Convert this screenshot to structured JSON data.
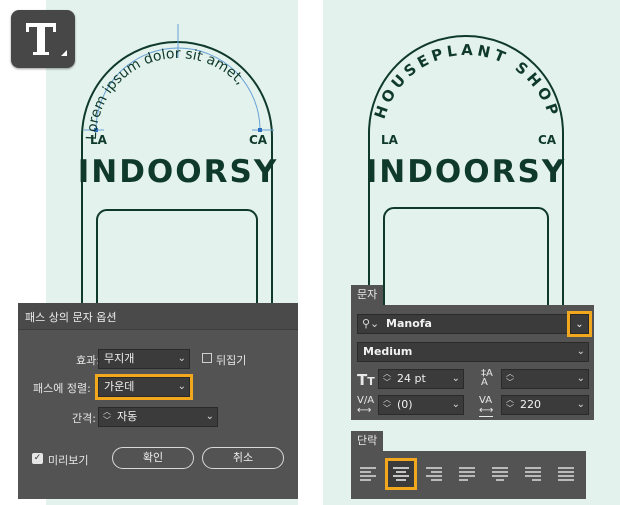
{
  "artwork": {
    "curve_text": "Lorem ipsum dolor sit amet,",
    "left_label": "LA",
    "right_label": "CA",
    "brand": "INDOORSY",
    "curve_text_final": "HOUSEPLANT SHOP",
    "left_label_final": "LA",
    "right_label_final": "CA",
    "brand_final": "INDOORSY",
    "ink_color": "#0f3a2b",
    "canvas_color": "#e3f2ec"
  },
  "type_on_path_dialog": {
    "title": "패스 상의 문자 옵션",
    "effect_label": "효과:",
    "effect_value": "무지개",
    "flip_label": "뒤집기",
    "align_label": "패스에 정렬:",
    "align_value": "가운데",
    "spacing_label": "간격:",
    "spacing_value": "자동",
    "preview_label": "미리보기",
    "preview_checked": true,
    "ok_label": "확인",
    "cancel_label": "취소"
  },
  "character_panel": {
    "tab_label": "문자",
    "font_family": "Manofa",
    "font_style": "Medium",
    "font_size": "24 pt",
    "leading": "",
    "kerning": "(0)",
    "tracking": "220"
  },
  "paragraph_panel": {
    "tab_label": "단락",
    "selected_alignment": "align-center",
    "buttons": [
      "align-left",
      "align-center",
      "align-right",
      "justify-last-left",
      "justify-last-center",
      "justify-last-right",
      "justify-all"
    ]
  },
  "accent_color": "#f3a71c"
}
